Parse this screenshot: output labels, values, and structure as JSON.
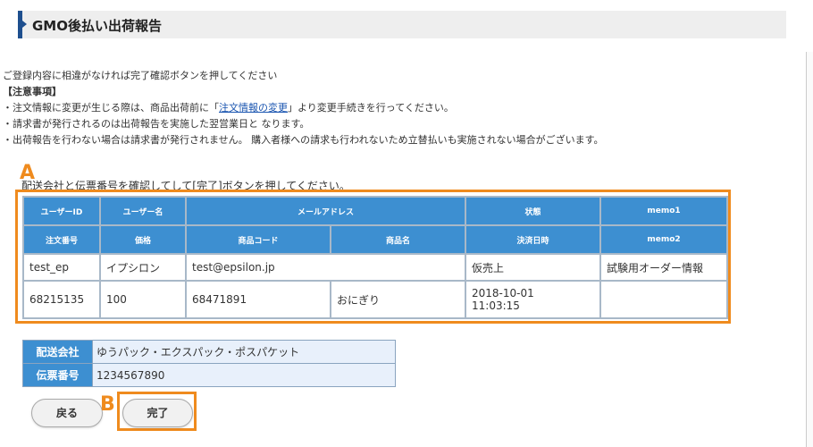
{
  "header": {
    "title": "GMO後払い出荷報告"
  },
  "notes": {
    "intro": "ご登録内容に相違がなければ完了確認ボタンを押してください",
    "heading": "【注意事項】",
    "item1_pre": "・注文情報に変更が生じる際は、商品出荷前に「",
    "item1_link": "注文情報の変更",
    "item1_post": "」より変更手続きを行ってください。",
    "item2": "・請求書が発行されるのは出荷報告を実施した翌営業日と なります。",
    "item3": "・出荷報告を行わない場合は請求書が発行されません。 購入者様への請求も行われないため立替払いも実施されない場合がございます。"
  },
  "annotations": {
    "a": "A",
    "b": "B"
  },
  "confirm_text": "配送会社と伝票番号を確認してして[完了]ボタンを押してください。",
  "order_table": {
    "headers_row1": [
      "ユーザーID",
      "ユーザー名",
      "メールアドレス",
      "状態",
      "memo1"
    ],
    "headers_row2": [
      "注文番号",
      "価格",
      "商品コード",
      "商品名",
      "決済日時",
      "memo2"
    ],
    "row1": {
      "user_id": "test_ep",
      "user_name": "イプシロン",
      "email": "test@epsilon.jp",
      "status": "仮売上",
      "memo1": "試験用オーダー情報"
    },
    "row2": {
      "order_no": "68215135",
      "price": "100",
      "product_code": "68471891",
      "product_name": "おにぎり",
      "paid_at_date": "2018-10-01",
      "paid_at_time": "11:03:15",
      "memo2": ""
    }
  },
  "shipping": {
    "carrier_label": "配送会社",
    "carrier_value": "ゆうパック・エクスパック・ポスパケット",
    "slip_label": "伝票番号",
    "slip_value": "1234567890"
  },
  "buttons": {
    "back": "戻る",
    "done": "完了"
  },
  "colors": {
    "accent_orange": "#ef8b1e",
    "header_blue": "#3d8fd1",
    "title_bar_accent": "#1e4f8e"
  }
}
